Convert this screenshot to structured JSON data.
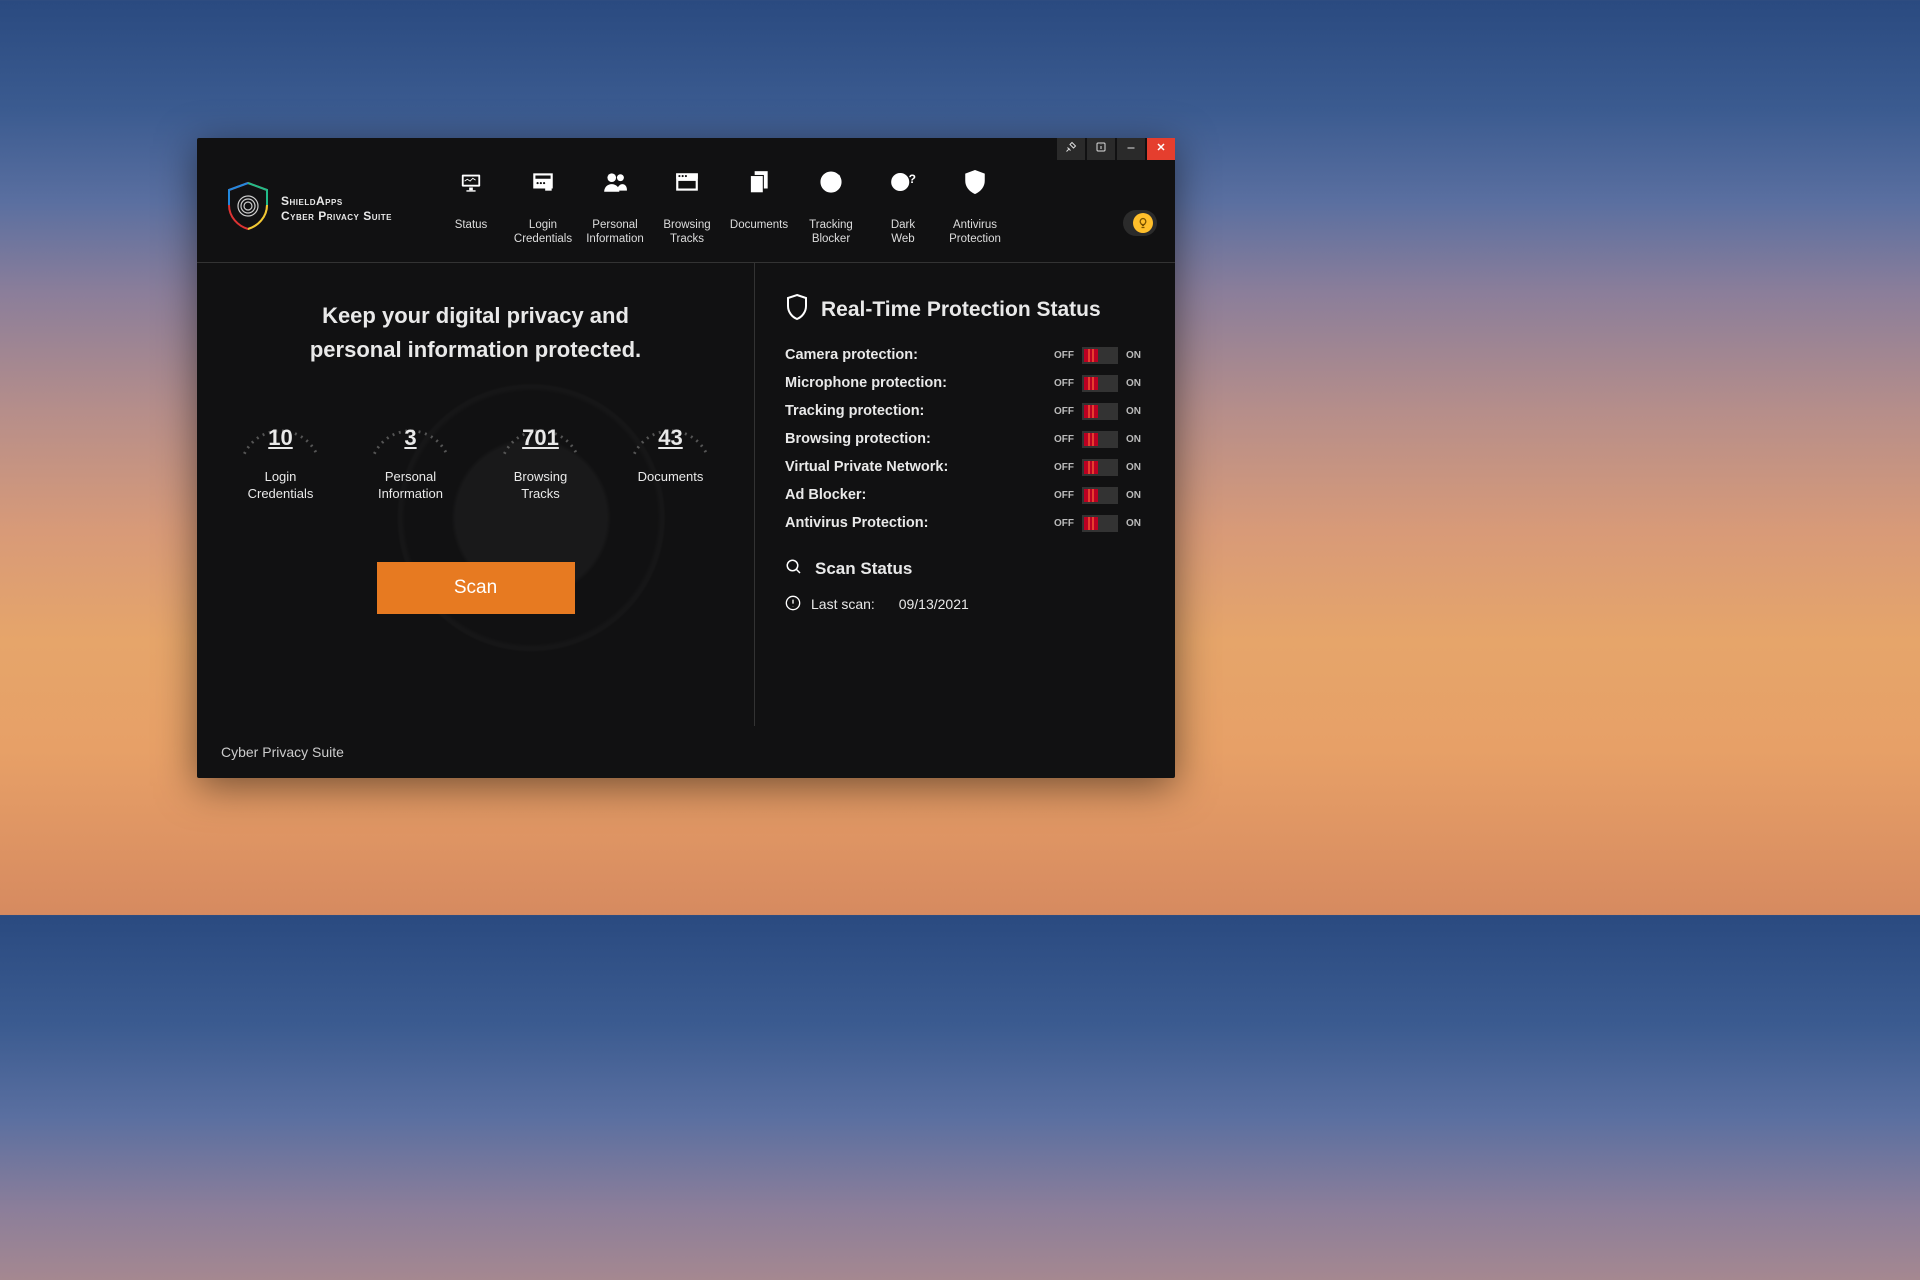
{
  "app": {
    "brand_line1": "ShieldApps",
    "brand_line2": "Cyber Privacy Suite"
  },
  "titlebar": {
    "tools_icon": "tools",
    "info_icon": "info",
    "minimize_icon": "minimize",
    "close_icon": "close"
  },
  "nav": [
    {
      "id": "status",
      "label": "Status",
      "icon": "monitor"
    },
    {
      "id": "login-credentials",
      "label": "Login Credentials",
      "icon": "lock"
    },
    {
      "id": "personal-information",
      "label": "Personal Information",
      "icon": "people"
    },
    {
      "id": "browsing-tracks",
      "label": "Browsing Tracks",
      "icon": "window"
    },
    {
      "id": "documents",
      "label": "Documents",
      "icon": "docs"
    },
    {
      "id": "tracking-blocker",
      "label": "Tracking Blocker",
      "icon": "radar"
    },
    {
      "id": "dark-web",
      "label": "Dark Web",
      "icon": "globe-question"
    },
    {
      "id": "antivirus-protection",
      "label": "Antivirus Protection",
      "icon": "shield-check"
    }
  ],
  "lamp_icon": "lightbulb",
  "headline_line1": "Keep your digital privacy and",
  "headline_line2": "personal information protected.",
  "gauges": [
    {
      "value": "10",
      "label": "Login Credentials"
    },
    {
      "value": "3",
      "label": "Personal Information"
    },
    {
      "value": "701",
      "label": "Browsing Tracks"
    },
    {
      "value": "43",
      "label": "Documents"
    }
  ],
  "scan_button": "Scan",
  "right": {
    "title": "Real-Time Protection Status",
    "off_label": "OFF",
    "on_label": "ON",
    "items": [
      {
        "label": "Camera protection:",
        "state": "off"
      },
      {
        "label": "Microphone protection:",
        "state": "off"
      },
      {
        "label": "Tracking protection:",
        "state": "off"
      },
      {
        "label": "Browsing protection:",
        "state": "off"
      },
      {
        "label": "Virtual Private Network:",
        "state": "off"
      },
      {
        "label": "Ad Blocker:",
        "state": "off"
      },
      {
        "label": "Antivirus Protection:",
        "state": "off"
      }
    ],
    "scan_status_title": "Scan Status",
    "last_scan_label": "Last scan:",
    "last_scan_date": "09/13/2021"
  },
  "footer": "Cyber Privacy Suite"
}
